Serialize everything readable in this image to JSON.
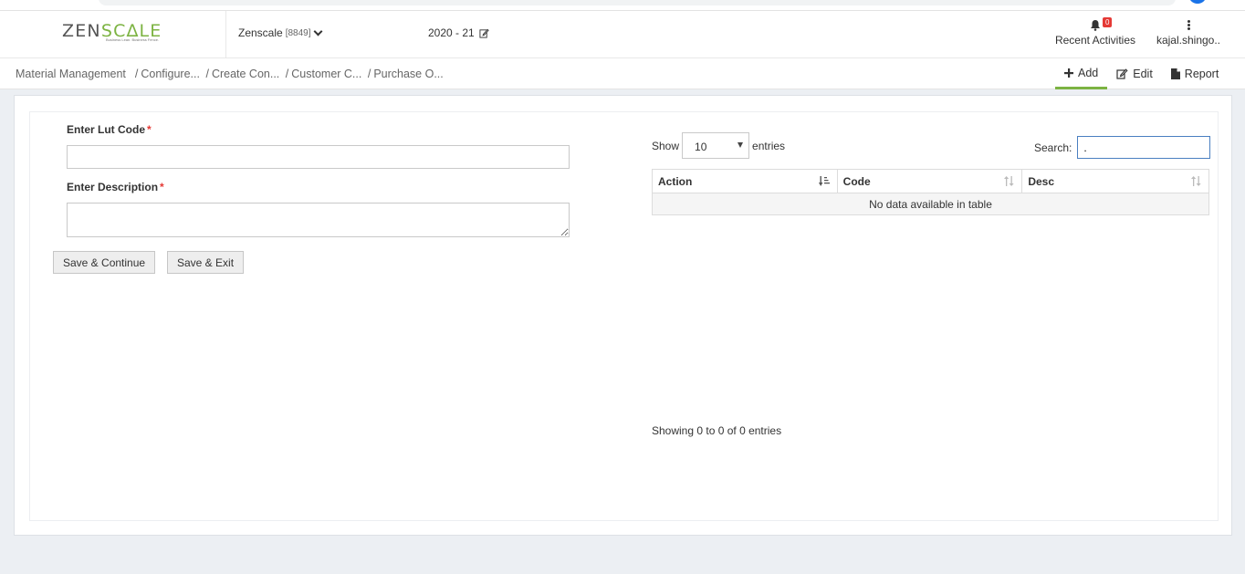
{
  "header": {
    "logo": {
      "main_a": "ZEN",
      "main_b": "SC",
      "main_c": "∆",
      "main_d": "LE",
      "tagline": "Business Lean. Business Fence."
    },
    "company": {
      "name": "Zenscale",
      "code": "[8849]"
    },
    "year": "2020 - 21",
    "recent": {
      "label": "Recent Activities",
      "count": "0"
    },
    "user": {
      "name": "kajal.shingo.."
    }
  },
  "breadcrumb": {
    "items": [
      "Material Management",
      "Configure...",
      "Create Con...",
      "Customer C...",
      "Purchase O..."
    ]
  },
  "actions": {
    "add": "Add",
    "edit": "Edit",
    "report": "Report"
  },
  "form": {
    "lut_code_label": "Enter Lut Code",
    "description_label": "Enter Description",
    "required_mark": "*",
    "lut_code_value": "",
    "description_value": "",
    "save_continue": "Save & Continue",
    "save_exit": "Save & Exit"
  },
  "table": {
    "show_label": "Show",
    "entries_label": "entries",
    "page_size": "10",
    "search_label": "Search:",
    "search_value": ".",
    "columns": [
      "Action",
      "Code",
      "Desc"
    ],
    "empty": "No data available in table",
    "info": "Showing 0 to 0 of 0 entries"
  },
  "colors": {
    "accent": "#7cb342",
    "required": "#e53935",
    "badge": "#e53935",
    "focus": "#4a7fc1"
  },
  "icons": {
    "bell": "bell-icon",
    "kebab": "kebab-icon",
    "add": "plus-icon",
    "edit": "edit-icon",
    "report": "file-icon",
    "sort": "sort-icon"
  }
}
